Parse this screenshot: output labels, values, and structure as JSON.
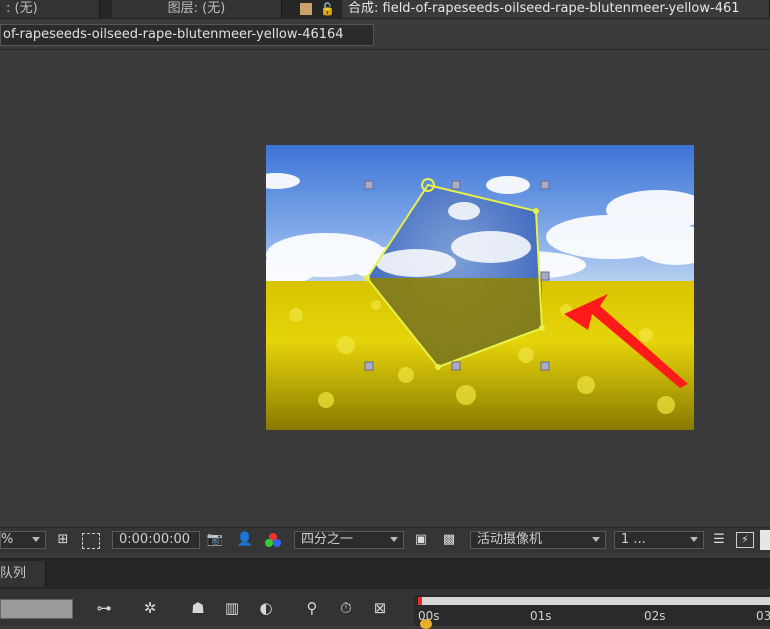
{
  "tabs": {
    "footage_label": ": (无)",
    "layer_label": "图层: (无)",
    "composition_label": "合成: field-of-rapeseeds-oilseed-rape-blutenmeer-yellow-461"
  },
  "comp_subtab": "of-rapeseeds-oilseed-rape-blutenmeer-yellow-46164",
  "viewer_toolbar": {
    "magnification": "%",
    "timecode": "0:00:00:00",
    "resolution": "四分之一",
    "camera": "活动摄像机",
    "views": "1 ..."
  },
  "panel": {
    "queue_tab": "队列"
  },
  "timeline": {
    "ruler_labels": [
      "00s",
      "01s",
      "02s",
      "03"
    ]
  },
  "colors": {
    "mask_stroke": "#e8f04a",
    "arrow": "#ff1a1a",
    "background": "#3b3b3b"
  }
}
